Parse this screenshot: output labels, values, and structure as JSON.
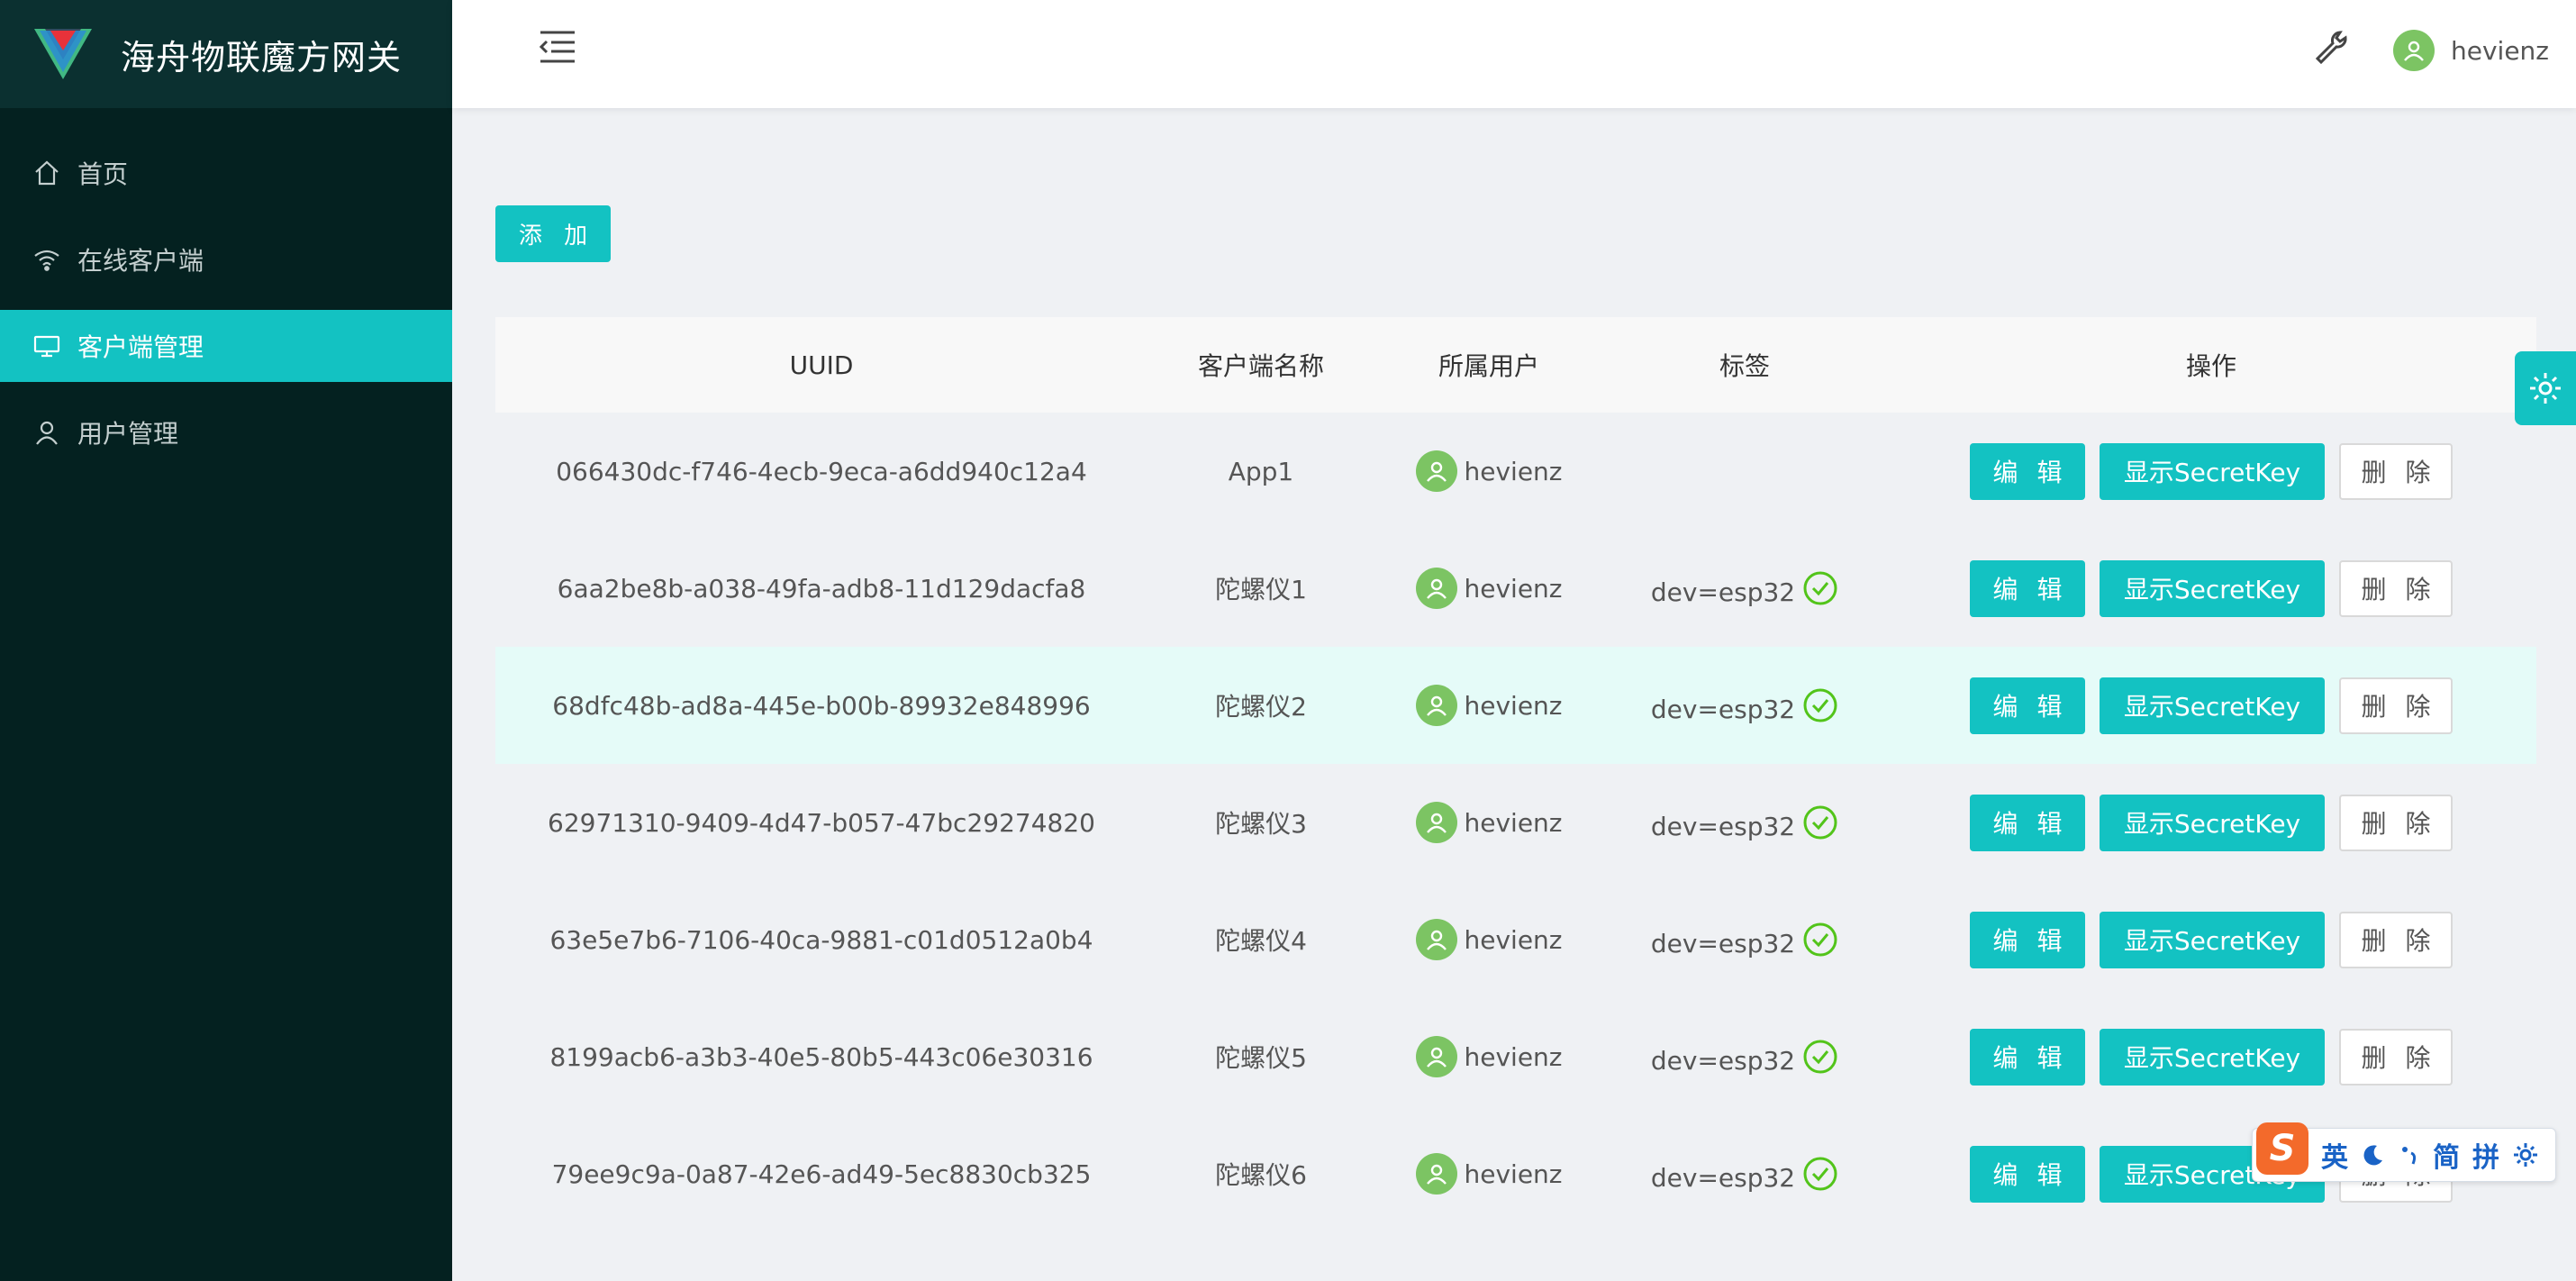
{
  "brand": {
    "title": "海舟物联魔方网关"
  },
  "sidebar": {
    "items": [
      {
        "label": "首页",
        "icon": "home-icon",
        "active": false
      },
      {
        "label": "在线客户端",
        "icon": "wifi-icon",
        "active": false
      },
      {
        "label": "客户端管理",
        "icon": "monitor-icon",
        "active": true
      },
      {
        "label": "用户管理",
        "icon": "user-icon",
        "active": false
      }
    ]
  },
  "header": {
    "user_name": "hevienz",
    "icons": [
      "menu-fold-icon",
      "wrench-icon",
      "user-avatar-icon"
    ]
  },
  "toolbar": {
    "add_label": "添 加"
  },
  "table": {
    "columns": [
      "UUID",
      "客户端名称",
      "所属用户",
      "标签",
      "操作"
    ],
    "rows": [
      {
        "uuid": "066430dc-f746-4ecb-9eca-a6dd940c12a4",
        "name": "App1",
        "user": "hevienz",
        "tag": ""
      },
      {
        "uuid": "6aa2be8b-a038-49fa-adb8-11d129dacfa8",
        "name": "陀螺仪1",
        "user": "hevienz",
        "tag": "dev=esp32"
      },
      {
        "uuid": "68dfc48b-ad8a-445e-b00b-89932e848996",
        "name": "陀螺仪2",
        "user": "hevienz",
        "tag": "dev=esp32"
      },
      {
        "uuid": "62971310-9409-4d47-b057-47bc29274820",
        "name": "陀螺仪3",
        "user": "hevienz",
        "tag": "dev=esp32"
      },
      {
        "uuid": "63e5e7b6-7106-40ca-9881-c01d0512a0b4",
        "name": "陀螺仪4",
        "user": "hevienz",
        "tag": "dev=esp32"
      },
      {
        "uuid": "8199acb6-a3b3-40e5-80b5-443c06e30316",
        "name": "陀螺仪5",
        "user": "hevienz",
        "tag": "dev=esp32"
      },
      {
        "uuid": "79ee9c9a-0a87-42e6-ad49-5ec8830cb325",
        "name": "陀螺仪6",
        "user": "hevienz",
        "tag": "dev=esp32"
      }
    ],
    "actions": {
      "edit": "编 辑",
      "secret": "显示SecretKey",
      "delete": "删 除"
    }
  },
  "ime": {
    "items": [
      "英",
      "简",
      "拼"
    ]
  },
  "colors": {
    "accent": "#13c2c2",
    "sidebar_bg": "#042120",
    "check": "#52c41a",
    "avatar": "#7cc463",
    "ime": "#f36a2b"
  }
}
